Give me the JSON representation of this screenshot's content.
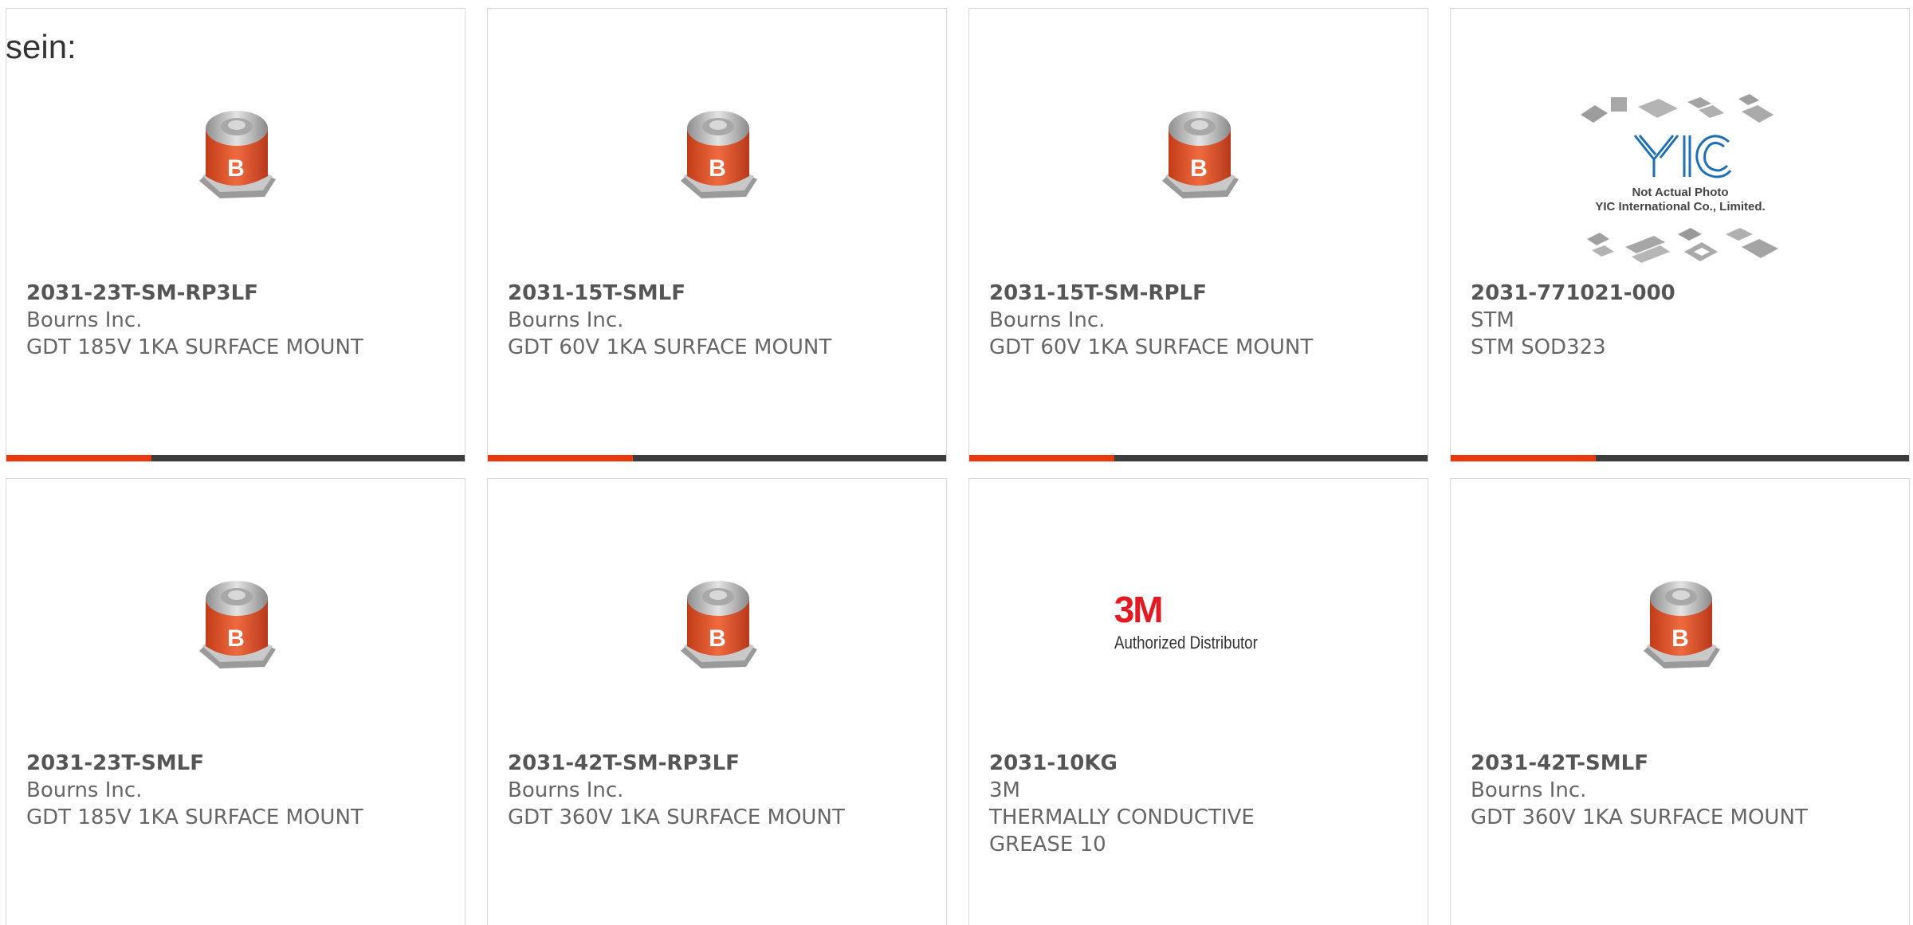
{
  "heading_fragment": "sein:",
  "colors": {
    "accent": "#e8380d",
    "bar": "#3d3d3d",
    "bourns_orange": "#e5582d",
    "brand_3m": "#e21b23",
    "yic_blue": "#1e6fb5"
  },
  "products": [
    {
      "part_number": "2031-23T-SM-RP3LF",
      "manufacturer": "Bourns Inc.",
      "description": "GDT 185V 1KA SURFACE MOUNT",
      "image": "bourns-gdt-component-icon"
    },
    {
      "part_number": "2031-15T-SMLF",
      "manufacturer": "Bourns Inc.",
      "description": "GDT 60V 1KA SURFACE MOUNT",
      "image": "bourns-gdt-component-icon"
    },
    {
      "part_number": "2031-15T-SM-RPLF",
      "manufacturer": "Bourns Inc.",
      "description": "GDT 60V 1KA SURFACE MOUNT",
      "image": "bourns-gdt-component-icon"
    },
    {
      "part_number": "2031-771021-000",
      "manufacturer": "STM",
      "description": "STM SOD323",
      "image": "yic-not-actual-photo",
      "image_text": {
        "line1": "Not Actual Photo",
        "line2": "YIC International Co., Limited."
      }
    },
    {
      "part_number": "2031-23T-SMLF",
      "manufacturer": "Bourns Inc.",
      "description": "GDT 185V 1KA SURFACE MOUNT",
      "image": "bourns-gdt-component-icon"
    },
    {
      "part_number": "2031-42T-SM-RP3LF",
      "manufacturer": "Bourns Inc.",
      "description": "GDT 360V 1KA SURFACE MOUNT",
      "image": "bourns-gdt-component-icon"
    },
    {
      "part_number": "2031-10KG",
      "manufacturer": "3M",
      "description": "THERMALLY CONDUCTIVE\nGREASE 10",
      "image": "3m-authorized-distributor-logo",
      "image_text": {
        "mark": "3M",
        "sub": "Authorized Distributor"
      }
    },
    {
      "part_number": "2031-42T-SMLF",
      "manufacturer": "Bourns Inc.",
      "description": "GDT 360V 1KA SURFACE MOUNT",
      "image": "bourns-gdt-component-icon"
    }
  ]
}
